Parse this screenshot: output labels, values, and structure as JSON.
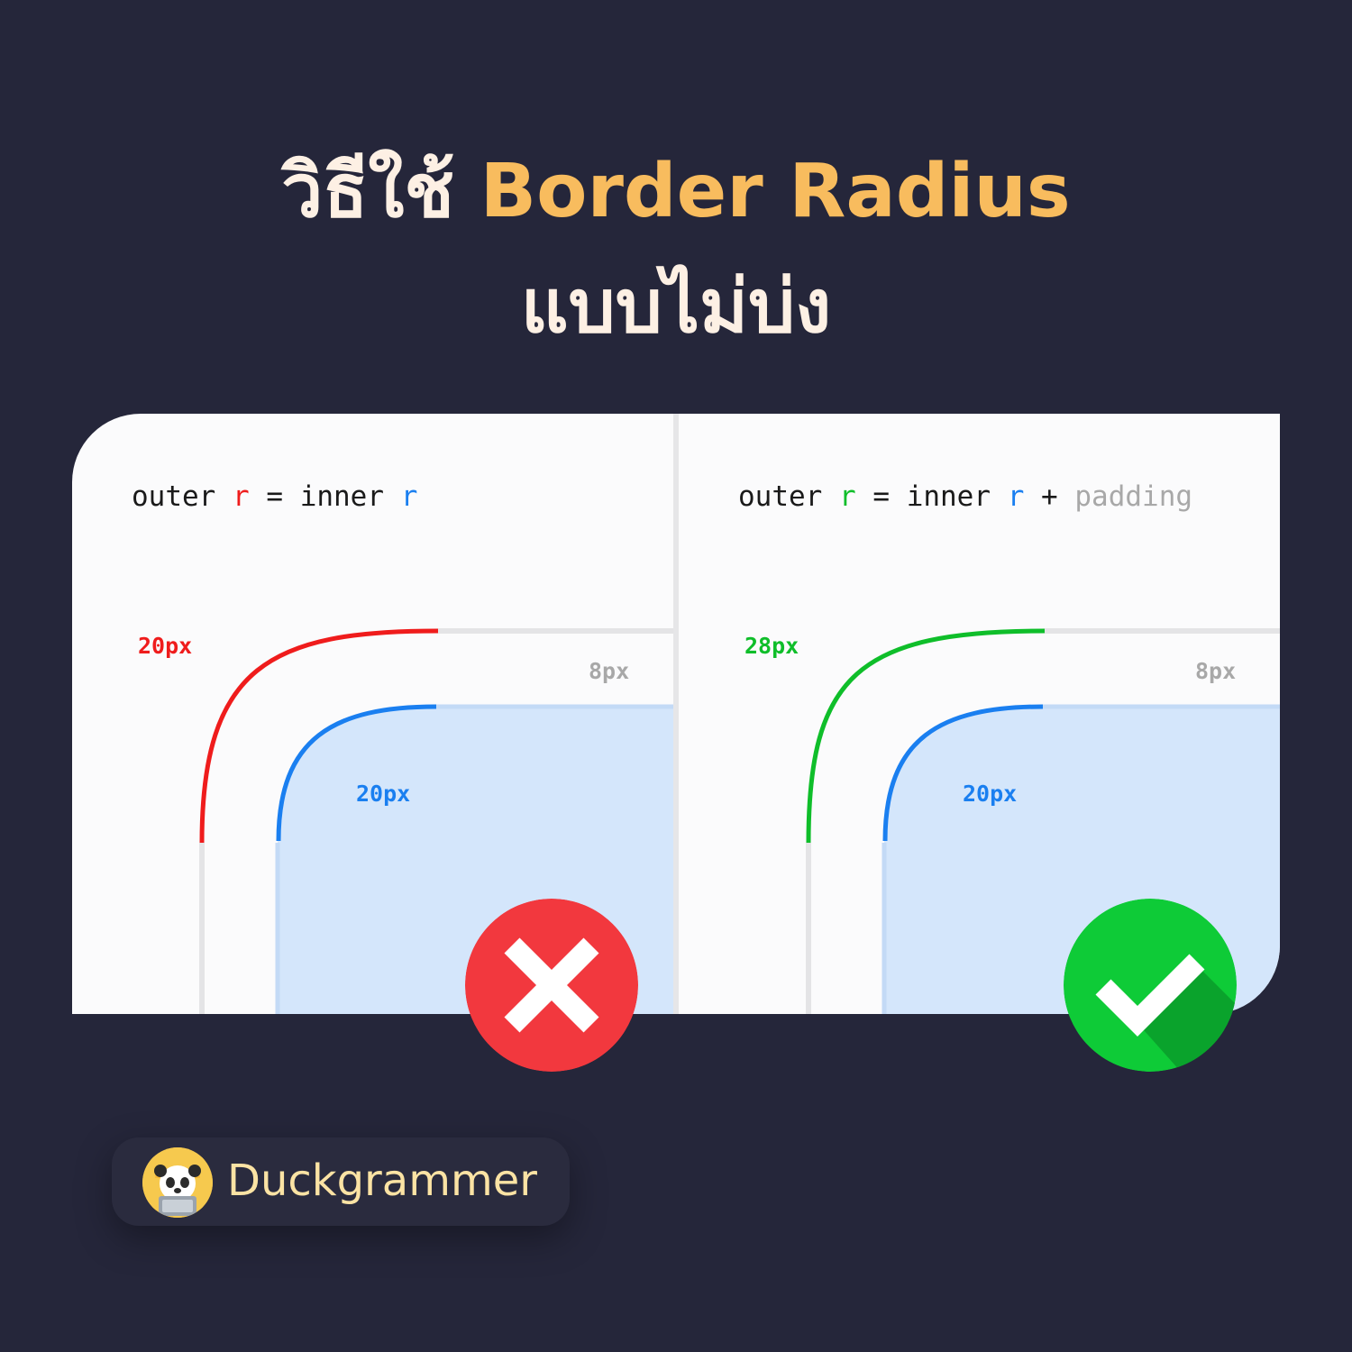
{
  "title": {
    "line1_thai": "วิธีใช้",
    "line1_accent": "Border Radius",
    "line2": "แบบไม่บ่ง"
  },
  "colors": {
    "background": "#25263a",
    "title_text": "#fdf0e4",
    "title_accent": "#f8bc5e",
    "wrong_outer": "#ef1c1c",
    "inner": "#1a7ff0",
    "right_outer": "#0fbe2a",
    "padding_label": "#a8a8a8",
    "inner_fill": "#d4e6fb"
  },
  "panels": {
    "wrong": {
      "formula": {
        "outer": "outer",
        "r1": "r",
        "eq": "=",
        "inner": "inner",
        "r2": "r"
      },
      "outer_label": "20px",
      "padding_label": "8px",
      "inner_label": "20px",
      "verdict_icon": "cross-icon"
    },
    "right": {
      "formula": {
        "outer": "outer",
        "r1": "r",
        "eq": "=",
        "inner": "inner",
        "r2": "r",
        "plus": "+",
        "padding": "padding"
      },
      "outer_label": "28px",
      "padding_label": "8px",
      "inner_label": "20px",
      "verdict_icon": "check-icon"
    }
  },
  "brand": {
    "name": "Duckgrammer",
    "avatar_icon": "panda-duck-avatar-icon"
  }
}
